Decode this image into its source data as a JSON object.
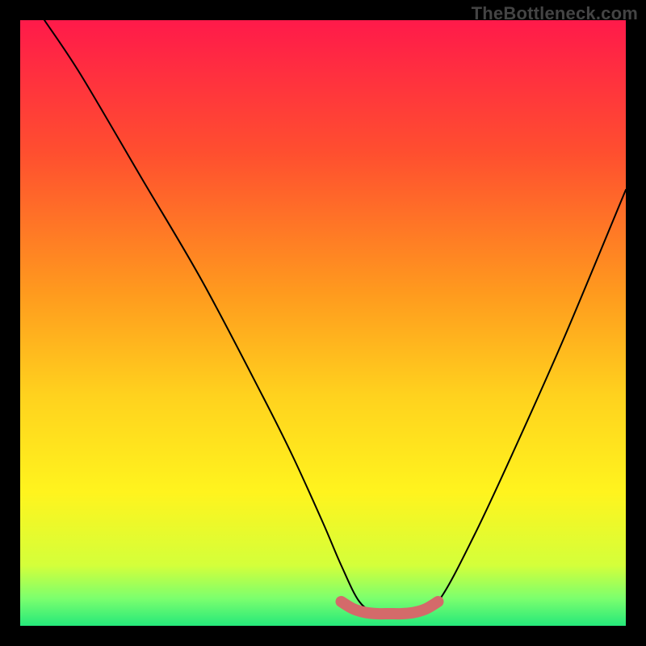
{
  "watermark": {
    "text": "TheBottleneck.com"
  },
  "chart_data": {
    "type": "line",
    "title": "",
    "xlabel": "",
    "ylabel": "",
    "xlim": [
      0,
      100
    ],
    "ylim": [
      0,
      100
    ],
    "series": [
      {
        "name": "curve",
        "x": [
          4,
          10,
          20,
          30,
          40,
          45,
          50,
          53,
          56,
          59,
          62,
          65,
          69,
          75,
          82,
          90,
          100
        ],
        "values": [
          100,
          91,
          74,
          57,
          38,
          28,
          17,
          10,
          4,
          2,
          2,
          2,
          4,
          15,
          30,
          48,
          72
        ]
      },
      {
        "name": "optimal-zone",
        "x": [
          53,
          55,
          57,
          59,
          61,
          63,
          65,
          67,
          69
        ],
        "values": [
          4,
          2.8,
          2.2,
          2,
          2,
          2,
          2.2,
          2.8,
          4
        ]
      }
    ],
    "gradient_stops": [
      {
        "offset": 0.0,
        "color": "#ff1a4a"
      },
      {
        "offset": 0.22,
        "color": "#ff4f2f"
      },
      {
        "offset": 0.45,
        "color": "#ff9a1e"
      },
      {
        "offset": 0.62,
        "color": "#ffd21e"
      },
      {
        "offset": 0.78,
        "color": "#fff41e"
      },
      {
        "offset": 0.9,
        "color": "#d4ff3a"
      },
      {
        "offset": 0.955,
        "color": "#7bff6e"
      },
      {
        "offset": 1.0,
        "color": "#25e87a"
      }
    ],
    "colors": {
      "curve_stroke": "#000000",
      "optimal_stroke": "#d46a6a",
      "background_frame": "#000000"
    }
  }
}
